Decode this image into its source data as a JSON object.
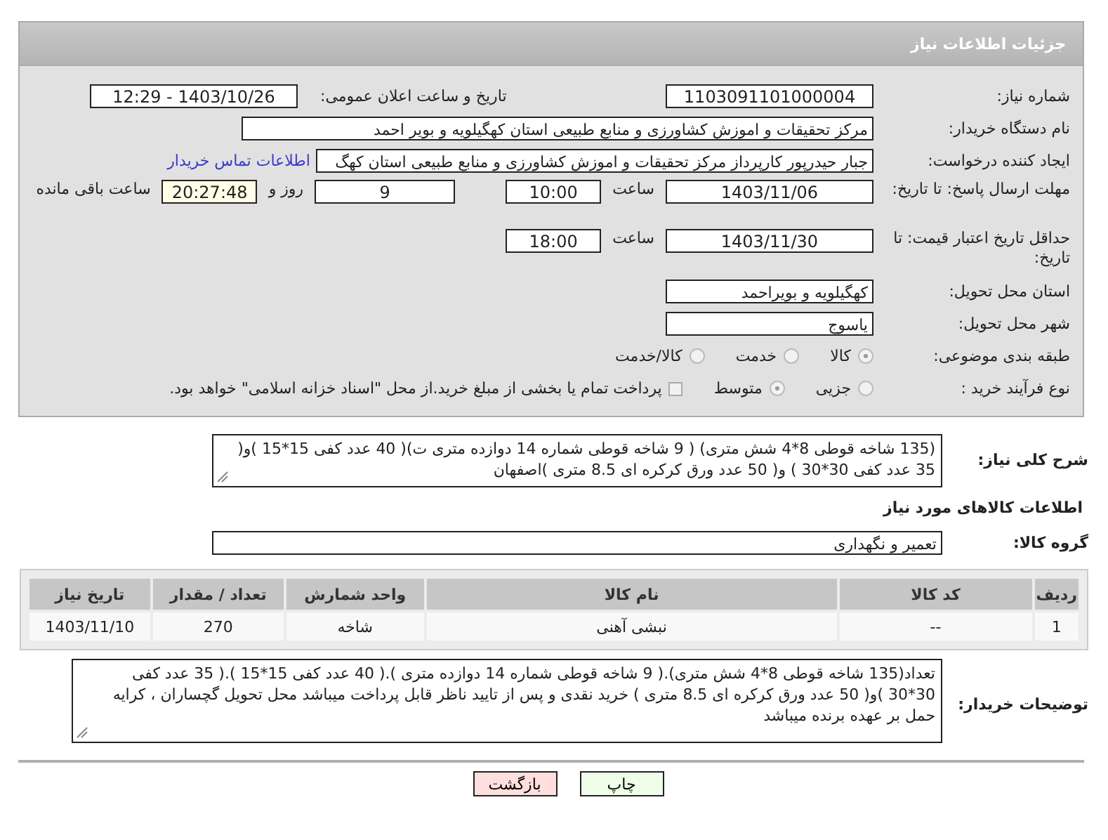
{
  "header": {
    "title": "جزئیات اطلاعات نیاز"
  },
  "need_number": {
    "label": "شماره نیاز:",
    "value": "1103091101000004"
  },
  "announce": {
    "label": "تاریخ و ساعت اعلان عمومی:",
    "value": "1403/10/26 - 12:29"
  },
  "buyer": {
    "label": "نام دستگاه خریدار:",
    "value": "مرکز تحقیقات و اموزش کشاورزی و منابع طبیعی استان کهگیلویه و بویر احمد"
  },
  "creator": {
    "label": "ایجاد کننده درخواست:",
    "value": "جبار حیدرپور کارپرداز مرکز تحقیقات و اموزش کشاورزی و منابع طبیعی استان کهگ",
    "link": "اطلاعات تماس خریدار"
  },
  "deadline": {
    "label": "مهلت ارسال پاسخ: تا تاریخ:",
    "date": "1403/11/06",
    "time_label": "ساعت",
    "time": "10:00",
    "days": "9",
    "days_label": "روز و",
    "remaining": "20:27:48",
    "remaining_label": "ساعت باقی مانده"
  },
  "validity": {
    "label": "حداقل تاریخ اعتبار قیمت: تا تاریخ:",
    "date": "1403/11/30",
    "time_label": "ساعت",
    "time": "18:00"
  },
  "province": {
    "label": "استان محل تحویل:",
    "value": "کهگیلویه و بویراحمد"
  },
  "city": {
    "label": "شهر محل تحویل:",
    "value": "یاسوج"
  },
  "category": {
    "label": "طبقه بندی موضوعی:",
    "options": [
      {
        "label": "کالا",
        "selected": true
      },
      {
        "label": "خدمت",
        "selected": false
      },
      {
        "label": "کالا/خدمت",
        "selected": false
      }
    ]
  },
  "purchase_type": {
    "label": "نوع فرآیند خرید :",
    "options": [
      {
        "label": "جزیی",
        "selected": false
      },
      {
        "label": "متوسط",
        "selected": true
      }
    ],
    "treasury": {
      "label": "پرداخت تمام یا بخشی از مبلغ خرید.از محل \"اسناد خزانه اسلامی\" خواهد بود.",
      "checked": false
    }
  },
  "description": {
    "label": "شرح کلی نیاز:",
    "value": "(135 شاخه قوطی 8*4 شش متری) ( 9 شاخه قوطی شماره 14 دوازده متری ت)( 40 عدد کفی 15*15 )و( 35 عدد کفی 30*30 ) و( 50 عدد ورق کرکره ای 8.5 متری )اصفهان"
  },
  "goods_heading": "اطلاعات کالاهای مورد نیاز",
  "goods_group": {
    "label": "گروه کالا:",
    "value": "تعمیر و نگهداری"
  },
  "table": {
    "columns": [
      "ردیف",
      "کد کالا",
      "نام کالا",
      "واحد شمارش",
      "تعداد / مقدار",
      "تاریخ نیاز"
    ],
    "rows": [
      [
        "1",
        "--",
        "نبشی آهنی",
        "شاخه",
        "270",
        "1403/11/10"
      ]
    ]
  },
  "buyer_notes": {
    "label": "توضیحات خریدار:",
    "value": "تعداد(135 شاخه قوطی 8*4 شش متری).( 9 شاخه قوطی شماره 14 دوازده متری ).( 40 عدد کفی 15*15 ).( 35 عدد کفی 30*30 )و( 50 عدد ورق کرکره ای 8.5 متری ) خرید نقدی و پس از تایید ناظر قابل پرداخت میباشد محل تحویل گچساران ، کرایه حمل بر عهده برنده میباشد"
  },
  "buttons": [
    {
      "label": "چاپ",
      "kind": "print"
    },
    {
      "label": "بازگشت",
      "kind": "back"
    }
  ]
}
